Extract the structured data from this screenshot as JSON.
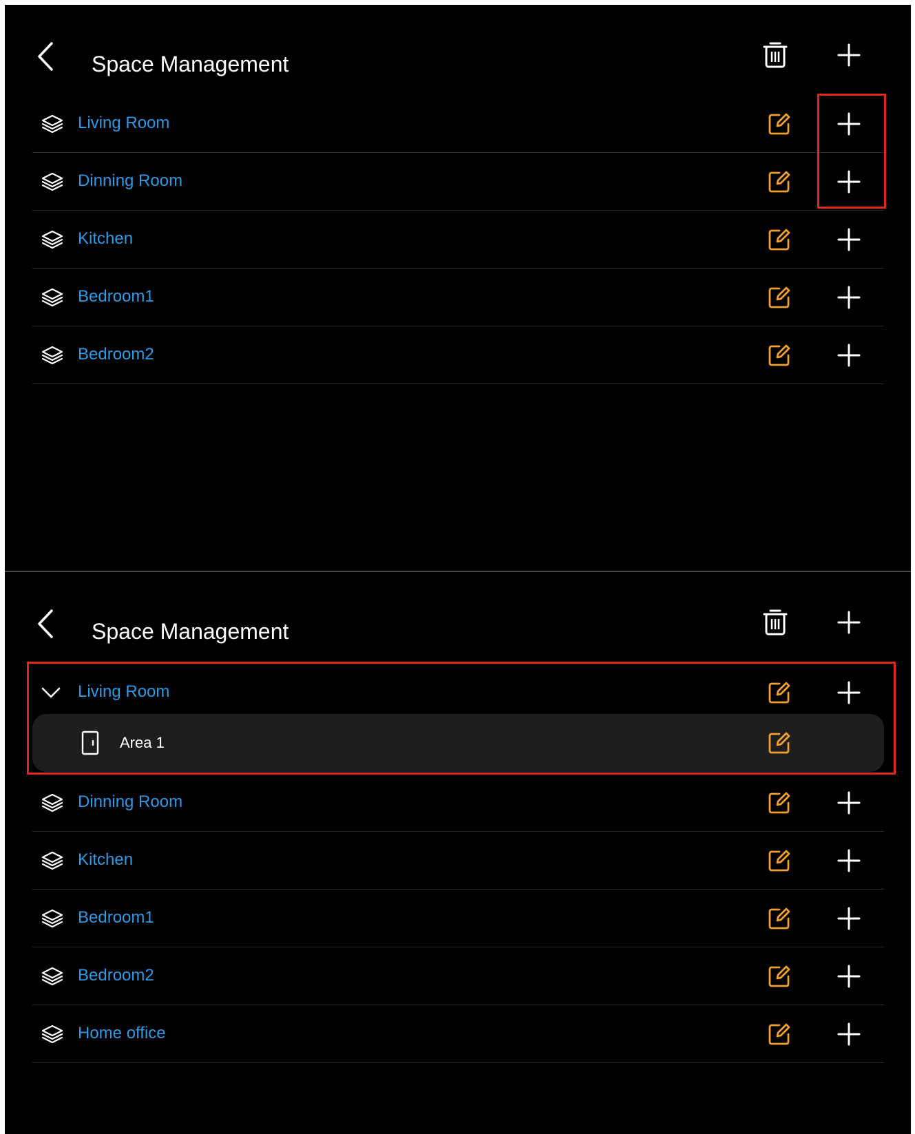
{
  "colors": {
    "background": "#000000",
    "room_label": "#2e9ae6",
    "edit_icon": "#f0a030",
    "highlight": "#e0271c",
    "sub_row_bg": "#1e1e1e"
  },
  "screen_top": {
    "title": "Space Management",
    "rooms": [
      {
        "label": "Living Room",
        "icon": "layers-icon"
      },
      {
        "label": "Dinning Room",
        "icon": "layers-icon"
      },
      {
        "label": "Kitchen",
        "icon": "layers-icon"
      },
      {
        "label": "Bedroom1",
        "icon": "layers-icon"
      },
      {
        "label": "Bedroom2",
        "icon": "layers-icon"
      }
    ]
  },
  "screen_bottom": {
    "title": "Space Management",
    "expanded_room": {
      "label": "Living Room",
      "icon": "chevron-down-icon"
    },
    "sub_areas": [
      {
        "label": "Area 1",
        "icon": "door-icon"
      }
    ],
    "rooms": [
      {
        "label": "Dinning Room",
        "icon": "layers-icon"
      },
      {
        "label": "Kitchen",
        "icon": "layers-icon"
      },
      {
        "label": "Bedroom1",
        "icon": "layers-icon"
      },
      {
        "label": "Bedroom2",
        "icon": "layers-icon"
      },
      {
        "label": "Home office",
        "icon": "layers-icon"
      }
    ]
  }
}
